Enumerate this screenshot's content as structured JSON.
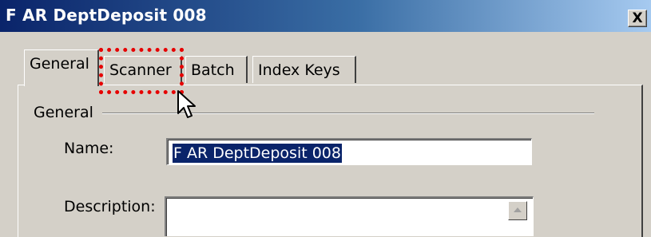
{
  "window": {
    "title": "F AR DeptDeposit 008",
    "close_glyph": "X"
  },
  "tabs": [
    {
      "label": "General",
      "selected": true
    },
    {
      "label": "Scanner",
      "selected": false
    },
    {
      "label": "Batch",
      "selected": false
    },
    {
      "label": "Index Keys",
      "selected": false
    }
  ],
  "general_group": {
    "label": "General"
  },
  "fields": {
    "name": {
      "label": "Name:",
      "value": "F AR DeptDeposit 008"
    },
    "description": {
      "label": "Description:",
      "value": ""
    }
  },
  "annotation": {
    "highlight_color": "#e60000",
    "highlighted_tab": "Scanner"
  },
  "colors": {
    "titlebar_start": "#0a246a",
    "titlebar_end": "#a6caf0",
    "window_bg": "#d4d0c8",
    "selection": "#0a246a"
  }
}
